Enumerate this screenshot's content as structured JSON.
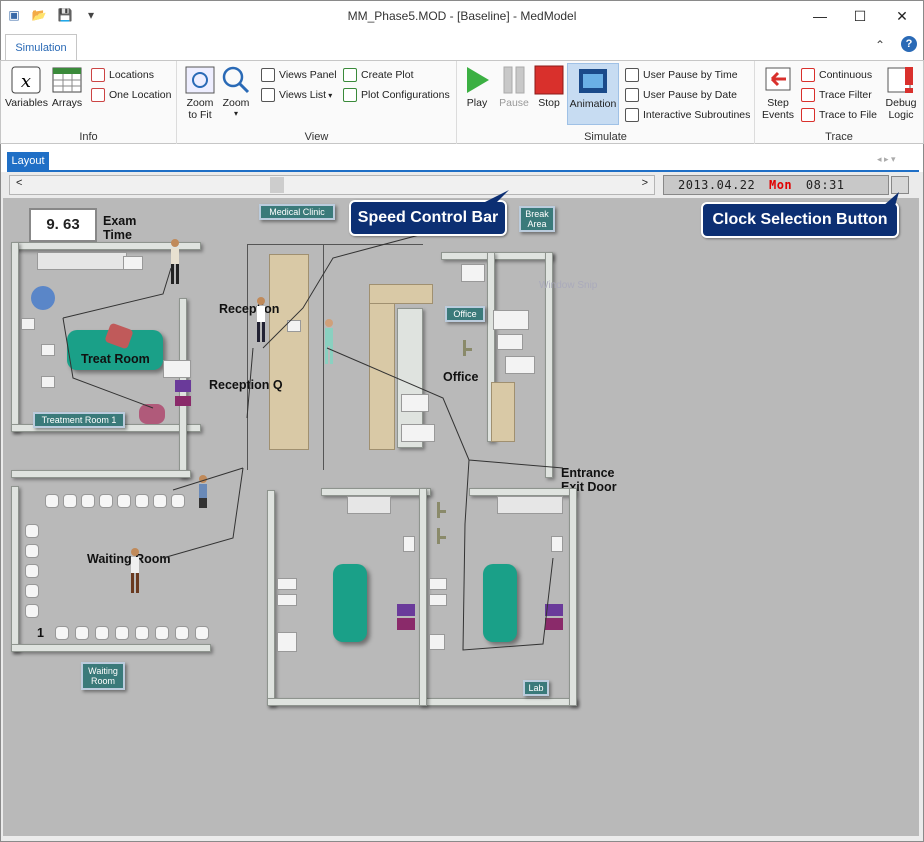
{
  "window": {
    "title": "MM_Phase5.MOD - [Baseline] - MedModel",
    "minimize": "—",
    "maximize": "☐",
    "close": "✕"
  },
  "ribbon": {
    "tab": "Simulation",
    "groups": {
      "info": {
        "label": "Info",
        "variables": "Variables",
        "arrays": "Arrays",
        "locations": "Locations",
        "one_location": "One Location"
      },
      "view": {
        "label": "View",
        "zoom_to_fit_1": "Zoom",
        "zoom_to_fit_2": "to Fit",
        "zoom": "Zoom",
        "views_panel": "Views Panel",
        "views_list": "Views List",
        "create_plot": "Create Plot",
        "plot_configurations": "Plot Configurations"
      },
      "simulate": {
        "label": "Simulate",
        "play": "Play",
        "pause": "Pause",
        "stop": "Stop",
        "animation": "Animation",
        "user_pause_time": "User Pause by Time",
        "user_pause_date": "User Pause by Date",
        "interactive_subroutines": "Interactive Subroutines"
      },
      "trace": {
        "label": "Trace",
        "step_events_1": "Step",
        "step_events_2": "Events",
        "continuous": "Continuous",
        "trace_filter": "Trace Filter",
        "trace_to_file": "Trace to File",
        "debug_logic_1": "Debug",
        "debug_logic_2": "Logic"
      }
    }
  },
  "document": {
    "tab": "Layout"
  },
  "clock": {
    "date": "2013.04.22",
    "day": "Mon",
    "time": "08:31",
    "day_color": "#e00000"
  },
  "callouts": {
    "speed": "Speed Control Bar",
    "clock": "Clock Selection Button"
  },
  "layout": {
    "exam_time_value": "9. 63",
    "exam_time_label_1": "Exam",
    "exam_time_label_2": "Time",
    "medical_clinic": "Medical Clinic",
    "break_area_1": "Break",
    "break_area_2": "Area",
    "treat_room": "Treat Room",
    "treatment_room_1": "Treatment Room 1",
    "reception": "Reception",
    "reception_q": "Reception Q",
    "office_label": "Office",
    "office_sign": "Office",
    "window_snip": "Window Snip",
    "entrance_1": "Entrance",
    "entrance_2": "Exit Door",
    "waiting_room": "Waiting Room",
    "waiting_sign_1": "Waiting",
    "waiting_sign_2": "Room",
    "waiting_count": "1",
    "lab": "Lab"
  }
}
